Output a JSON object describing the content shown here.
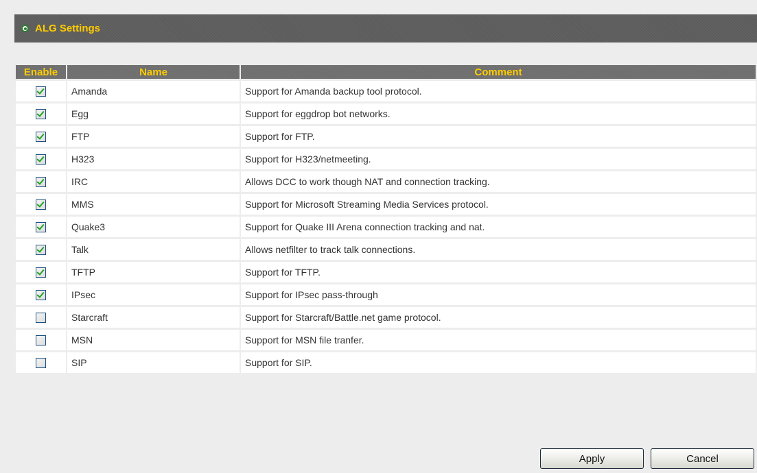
{
  "header": {
    "title": "ALG Settings"
  },
  "table": {
    "columns": [
      "Enable",
      "Name",
      "Comment"
    ],
    "rows": [
      {
        "enabled": true,
        "name": "Amanda",
        "comment": "Support for Amanda backup tool protocol."
      },
      {
        "enabled": true,
        "name": "Egg",
        "comment": "Support for eggdrop bot networks."
      },
      {
        "enabled": true,
        "name": "FTP",
        "comment": "Support for FTP."
      },
      {
        "enabled": true,
        "name": "H323",
        "comment": "Support for H323/netmeeting."
      },
      {
        "enabled": true,
        "name": "IRC",
        "comment": "Allows DCC to work though NAT and connection tracking."
      },
      {
        "enabled": true,
        "name": "MMS",
        "comment": "Support for Microsoft Streaming Media Services protocol."
      },
      {
        "enabled": true,
        "name": "Quake3",
        "comment": "Support for Quake III Arena connection tracking and nat."
      },
      {
        "enabled": true,
        "name": "Talk",
        "comment": "Allows netfilter to track talk connections."
      },
      {
        "enabled": true,
        "name": "TFTP",
        "comment": "Support for TFTP."
      },
      {
        "enabled": true,
        "name": "IPsec",
        "comment": "Support for IPsec pass-through"
      },
      {
        "enabled": false,
        "name": "Starcraft",
        "comment": "Support for Starcraft/Battle.net game protocol."
      },
      {
        "enabled": false,
        "name": "MSN",
        "comment": "Support for MSN file tranfer."
      },
      {
        "enabled": false,
        "name": "SIP",
        "comment": "Support for SIP."
      }
    ]
  },
  "buttons": {
    "apply": "Apply",
    "cancel": "Cancel"
  },
  "colors": {
    "header_bg": "#5c5c5c",
    "header_text": "#ffcc00",
    "check": "#21a121"
  }
}
